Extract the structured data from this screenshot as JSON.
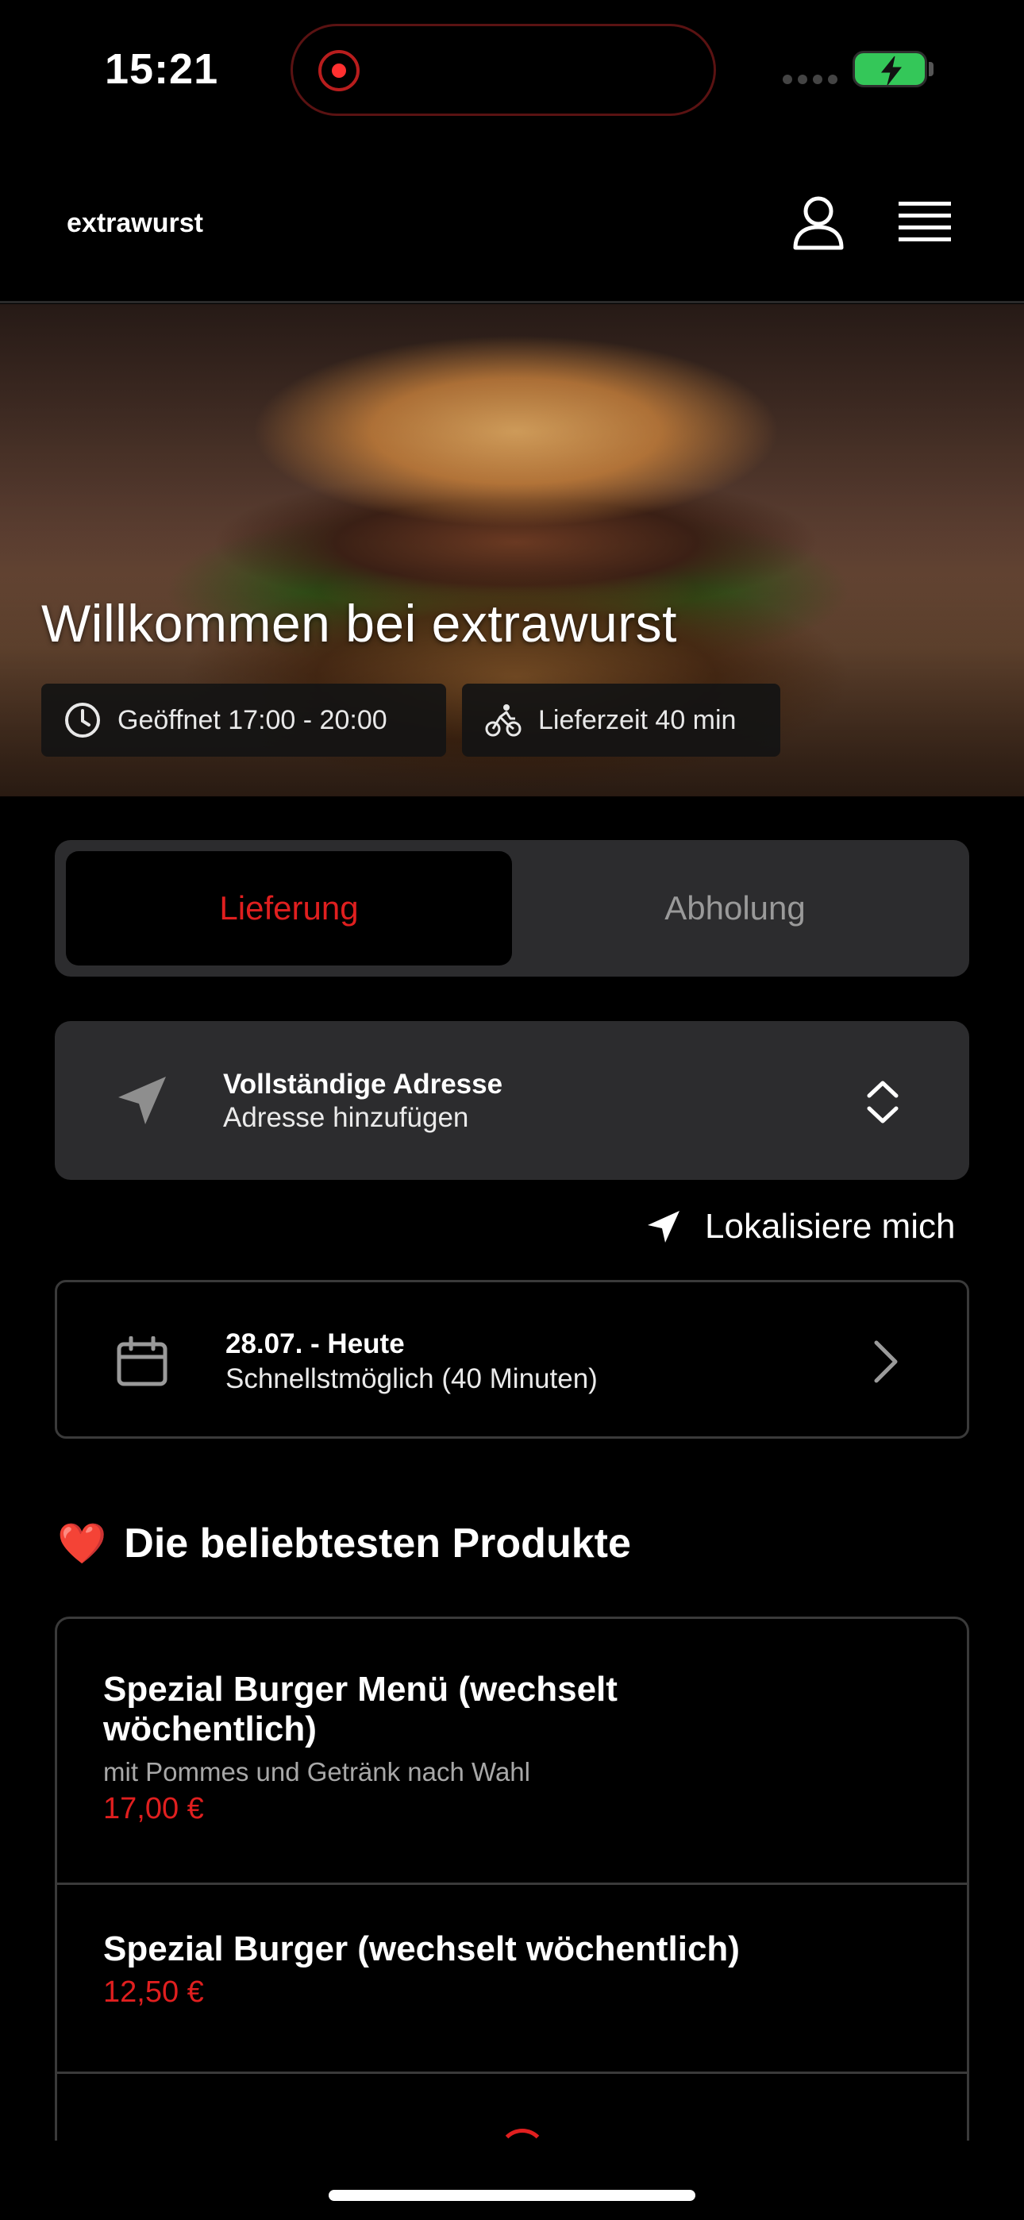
{
  "status_bar": {
    "time": "15:21"
  },
  "header": {
    "brand": "extrawurst",
    "icons": [
      "user-icon",
      "menu-icon"
    ]
  },
  "hero": {
    "title": "Willkommen bei extrawurst",
    "open_hours": "Geöffnet 17:00 - 20:00",
    "delivery_time": "Lieferzeit 40 min"
  },
  "order_mode": {
    "active": "Lieferung",
    "inactive": "Abholung"
  },
  "address": {
    "title": "Vollständige Adresse",
    "subtitle": "Adresse hinzufügen"
  },
  "locate": {
    "label": "Lokalisiere mich"
  },
  "date": {
    "title": "28.07. - Heute",
    "subtitle": "Schnellstmöglich (40 Minuten)"
  },
  "popular": {
    "emoji": "❤️",
    "title": "Die beliebtesten Produkte",
    "products": [
      {
        "name": "Spezial Burger Menü (wechselt wöchentlich)",
        "description": "mit Pommes und Getränk nach Wahl",
        "price": "17,00 €"
      },
      {
        "name": "Spezial Burger (wechselt wöchentlich)",
        "price": "12,50 €"
      }
    ]
  },
  "colors": {
    "accent": "#e01f1f",
    "card": "#2c2c2e",
    "background": "#000000",
    "battery": "#34c759"
  }
}
